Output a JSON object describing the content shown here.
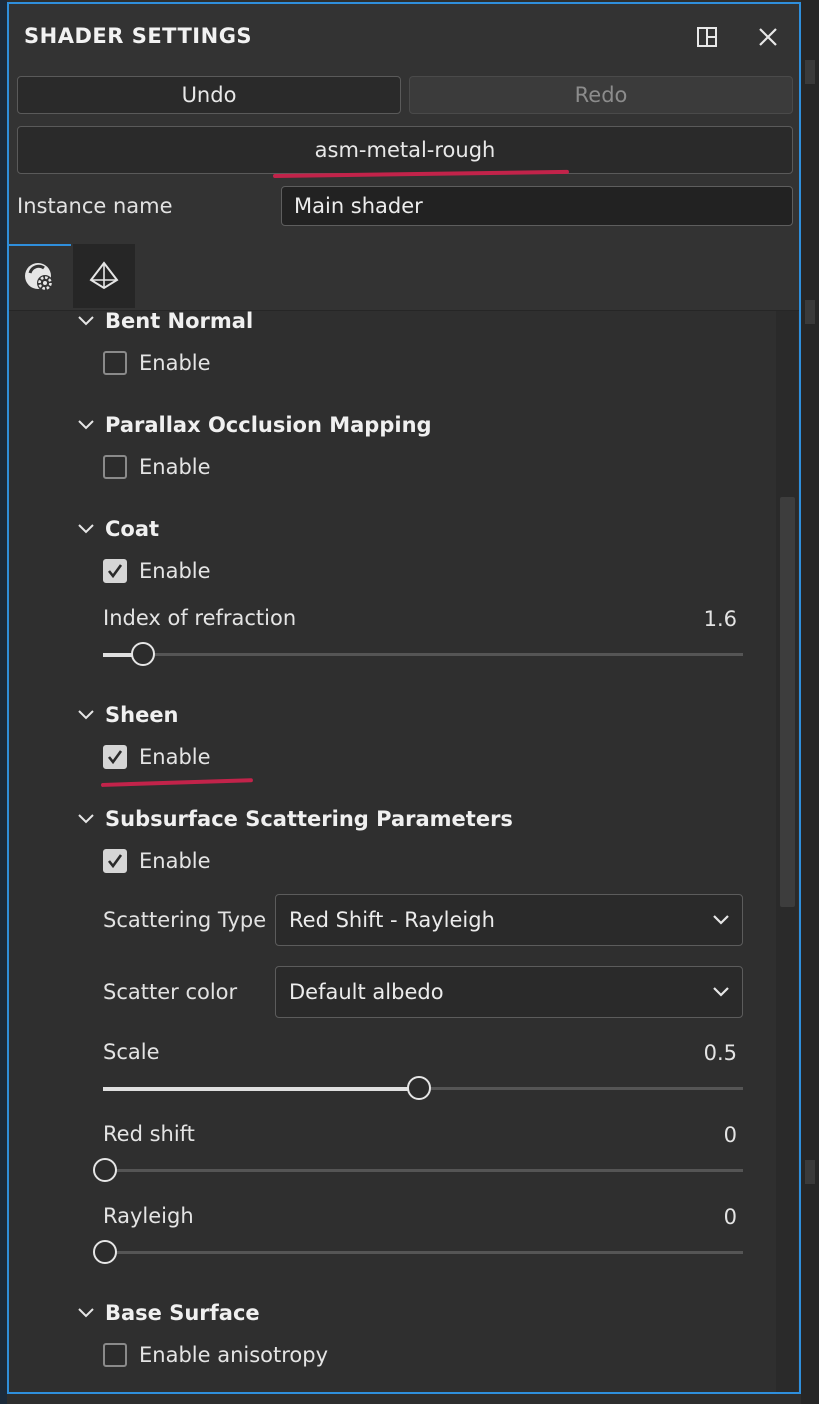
{
  "window": {
    "title": "SHADER SETTINGS",
    "icons": {
      "layout": "panel-layout-icon",
      "close": "close-icon"
    }
  },
  "toolbar": {
    "undo_label": "Undo",
    "redo_label": "Redo"
  },
  "shader": {
    "name": "asm-metal-rough",
    "instance_label": "Instance name",
    "instance_value": "Main shader"
  },
  "tabs": [
    {
      "icon": "shader-settings-icon",
      "active": true
    },
    {
      "icon": "geometry-icon",
      "active": false
    }
  ],
  "sections": {
    "bent_normal": {
      "title": "Bent Normal",
      "enable_label": "Enable",
      "enabled": false
    },
    "pom": {
      "title": "Parallax Occlusion Mapping",
      "enable_label": "Enable",
      "enabled": false
    },
    "coat": {
      "title": "Coat",
      "enable_label": "Enable",
      "enabled": true,
      "ior_label": "Index of refraction",
      "ior_value": "1.6",
      "ior_fraction": 0.06
    },
    "sheen": {
      "title": "Sheen",
      "enable_label": "Enable",
      "enabled": true
    },
    "sss": {
      "title": "Subsurface Scattering Parameters",
      "enable_label": "Enable",
      "enabled": true,
      "scattering_type_label": "Scattering Type",
      "scattering_type_value": "Red Shift - Rayleigh",
      "scatter_color_label": "Scatter color",
      "scatter_color_value": "Default albedo",
      "scale_label": "Scale",
      "scale_value": "0.5",
      "scale_fraction": 0.49,
      "red_shift_label": "Red shift",
      "red_shift_value": "0",
      "red_shift_fraction": 0.0,
      "rayleigh_label": "Rayleigh",
      "rayleigh_value": "0",
      "rayleigh_fraction": 0.0
    },
    "base_surface": {
      "title": "Base Surface",
      "anisotropy_label": "Enable anisotropy",
      "anisotropy_enabled": false
    }
  },
  "colors": {
    "accent_border": "#2f8fdc",
    "annotation_red": "#c2234a"
  }
}
